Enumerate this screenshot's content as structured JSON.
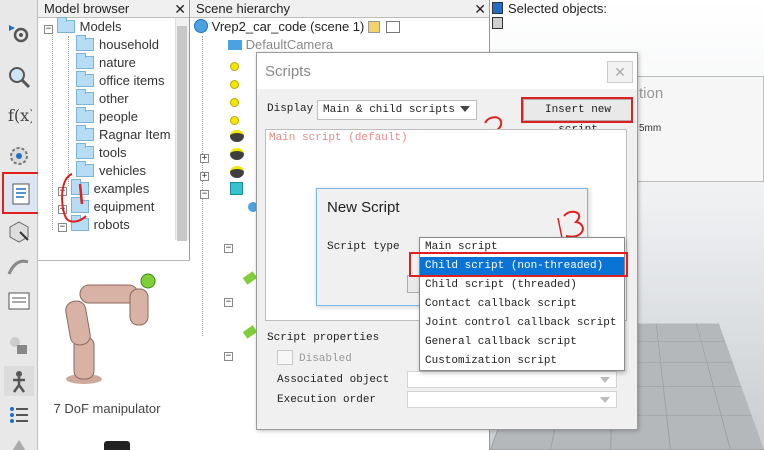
{
  "model_browser": {
    "title": "Model browser",
    "close": "✕",
    "items": [
      {
        "label": "Models",
        "expanded": true
      },
      {
        "label": "household"
      },
      {
        "label": "nature"
      },
      {
        "label": "office items"
      },
      {
        "label": "other"
      },
      {
        "label": "people"
      },
      {
        "label": "Ragnar Item"
      },
      {
        "label": "tools"
      },
      {
        "label": "vehicles"
      },
      {
        "label": "examples"
      },
      {
        "label": "equipment"
      },
      {
        "label": "robots",
        "expanded": true
      }
    ],
    "preview_caption": "7 DoF manipulator"
  },
  "scene_hierarchy": {
    "title": "Scene hierarchy",
    "close": "✕",
    "scene_name": "Vrep2_car_code (scene 1)",
    "first_child": "DefaultCamera"
  },
  "selection_bar": {
    "label": "Selected objects:"
  },
  "background_dialog": {
    "title_fragment": "tion",
    "value_fragment": "5mm"
  },
  "scripts_dialog": {
    "title": "Scripts",
    "close": "✕",
    "display_label": "Display",
    "display_value": "Main & child scripts",
    "insert_button": "Insert new script",
    "script_list": [
      "Main script (default)"
    ],
    "properties_label": "Script properties",
    "disabled_label": "Disabled",
    "associated_object_label": "Associated object",
    "execution_order_label": "Execution order"
  },
  "new_script_dialog": {
    "title": "New Script",
    "script_type_label": "Script type",
    "options": [
      "Main script",
      "Child script (non-threaded)",
      "Child script (threaded)",
      "Contact callback script",
      "Joint control callback script",
      "General callback script",
      "Customization script"
    ],
    "selected_index": 1
  },
  "annotations": [
    "1",
    "2",
    "3"
  ],
  "colors": {
    "annotation_red": "#e02020",
    "selection_blue": "#0a74d6",
    "folder_blue": "#b7ddf4"
  }
}
